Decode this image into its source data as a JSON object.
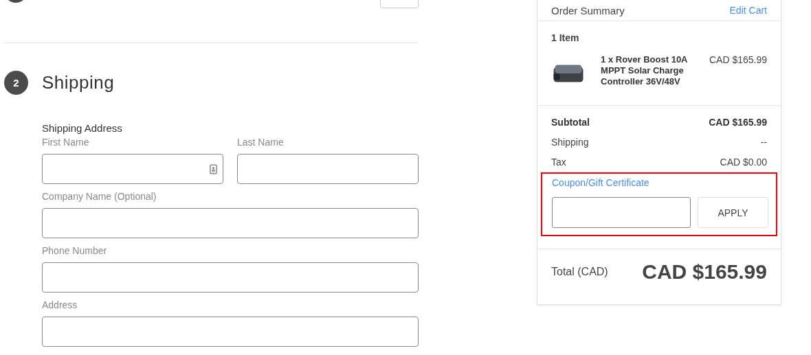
{
  "shipping_step": {
    "number": "2",
    "title": "Shipping",
    "section_label": "Shipping Address",
    "fields": [
      {
        "label": "First Name",
        "autofill_icon": true
      },
      {
        "label": "Last Name",
        "autofill_icon": false
      },
      {
        "label": "Company Name (Optional)",
        "autofill_icon": false
      },
      {
        "label": "Phone Number",
        "autofill_icon": false
      },
      {
        "label": "Address",
        "autofill_icon": false
      }
    ]
  },
  "order_summary": {
    "title": "Order Summary",
    "edit_link": "Edit Cart",
    "item_count": "1 Item",
    "items": [
      {
        "name": "1 x Rover Boost 10A MPPT Solar Charge Controller 36V/48V",
        "price": "CAD $165.99"
      }
    ],
    "lines": [
      {
        "label": "Subtotal",
        "value": "CAD $165.99",
        "bold": true
      },
      {
        "label": "Shipping",
        "value": "--",
        "bold": false
      },
      {
        "label": "Tax",
        "value": "CAD $0.00",
        "bold": false
      }
    ],
    "coupon": {
      "label": "Coupon/Gift Certificate",
      "button": "APPLY",
      "highlighted": true
    },
    "total_label": "Total (CAD)",
    "total": "CAD $165.99"
  }
}
